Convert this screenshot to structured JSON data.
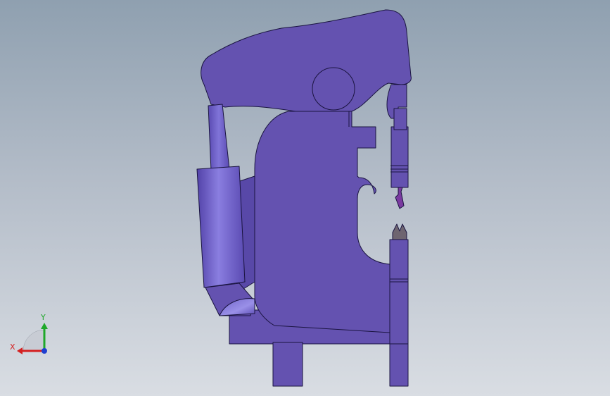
{
  "viewport": {
    "background_top": "#8fa0b0",
    "background_bottom": "#d9dde3"
  },
  "model": {
    "body_color": "#6452b0",
    "body_shadow": "#4e3f95",
    "edge_color": "#1a1440",
    "cylinder_highlight": "#8a7ee0",
    "tool_color": "#6e6470",
    "punch_tip_color": "#7a3aa0"
  },
  "triad": {
    "x_label": "X",
    "y_label": "Y",
    "x_color": "#d42020",
    "y_color": "#1fa82a",
    "z_color": "#1f3fd0"
  }
}
